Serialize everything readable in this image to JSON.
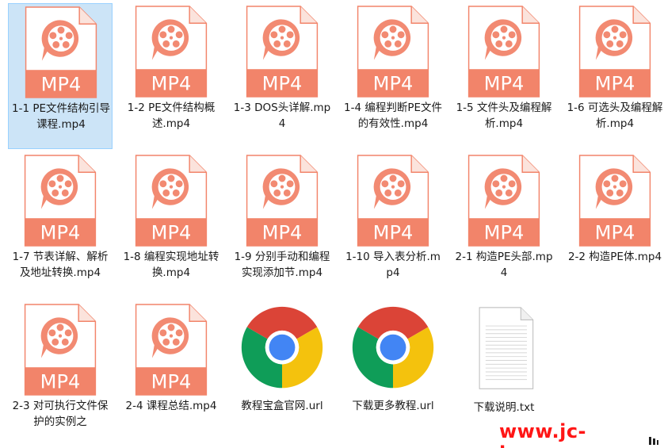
{
  "colors": {
    "mp4_band": "#f2846a",
    "mp4_outline": "#f2846a",
    "mp4_reel": "#f28a72",
    "selection": "#cce4f7",
    "watermark": "#ff1616"
  },
  "files": [
    {
      "name": "1-1 PE文件结构引导课程.mp4",
      "type": "mp4",
      "badge": "MP4",
      "icon": "video-file-icon",
      "selected": true
    },
    {
      "name": "1-2 PE文件结构概述.mp4",
      "type": "mp4",
      "badge": "MP4",
      "icon": "video-file-icon"
    },
    {
      "name": "1-3 DOS头详解.mp4",
      "type": "mp4",
      "badge": "MP4",
      "icon": "video-file-icon"
    },
    {
      "name": "1-4 编程判断PE文件的有效性.mp4",
      "type": "mp4",
      "badge": "MP4",
      "icon": "video-file-icon"
    },
    {
      "name": "1-5 文件头及编程解析.mp4",
      "type": "mp4",
      "badge": "MP4",
      "icon": "video-file-icon"
    },
    {
      "name": "1-6 可选头及编程解析.mp4",
      "type": "mp4",
      "badge": "MP4",
      "icon": "video-file-icon"
    },
    {
      "name": "1-7 节表详解、解析及地址转换.mp4",
      "type": "mp4",
      "badge": "MP4",
      "icon": "video-file-icon"
    },
    {
      "name": "1-8 编程实现地址转换.mp4",
      "type": "mp4",
      "badge": "MP4",
      "icon": "video-file-icon"
    },
    {
      "name": "1-9 分别手动和编程实现添加节.mp4",
      "type": "mp4",
      "badge": "MP4",
      "icon": "video-file-icon"
    },
    {
      "name": "1-10 导入表分析.mp4",
      "type": "mp4",
      "badge": "MP4",
      "icon": "video-file-icon"
    },
    {
      "name": "2-1 构造PE头部.mp4",
      "type": "mp4",
      "badge": "MP4",
      "icon": "video-file-icon"
    },
    {
      "name": "2-2 构造PE体.mp4",
      "type": "mp4",
      "badge": "MP4",
      "icon": "video-file-icon"
    },
    {
      "name": "2-3 对可执行文件保护的实例之",
      "type": "mp4",
      "badge": "MP4",
      "icon": "video-file-icon"
    },
    {
      "name": "2-4 课程总结.mp4",
      "type": "mp4",
      "badge": "MP4",
      "icon": "video-file-icon"
    },
    {
      "name": "教程宝盒官网.url",
      "type": "url",
      "icon": "chrome-icon"
    },
    {
      "name": "下载更多教程.url",
      "type": "url",
      "icon": "chrome-icon"
    },
    {
      "name": "下载说明.txt",
      "type": "txt",
      "icon": "text-file-icon"
    }
  ],
  "watermark": {
    "text": "www.jc-box.com"
  }
}
